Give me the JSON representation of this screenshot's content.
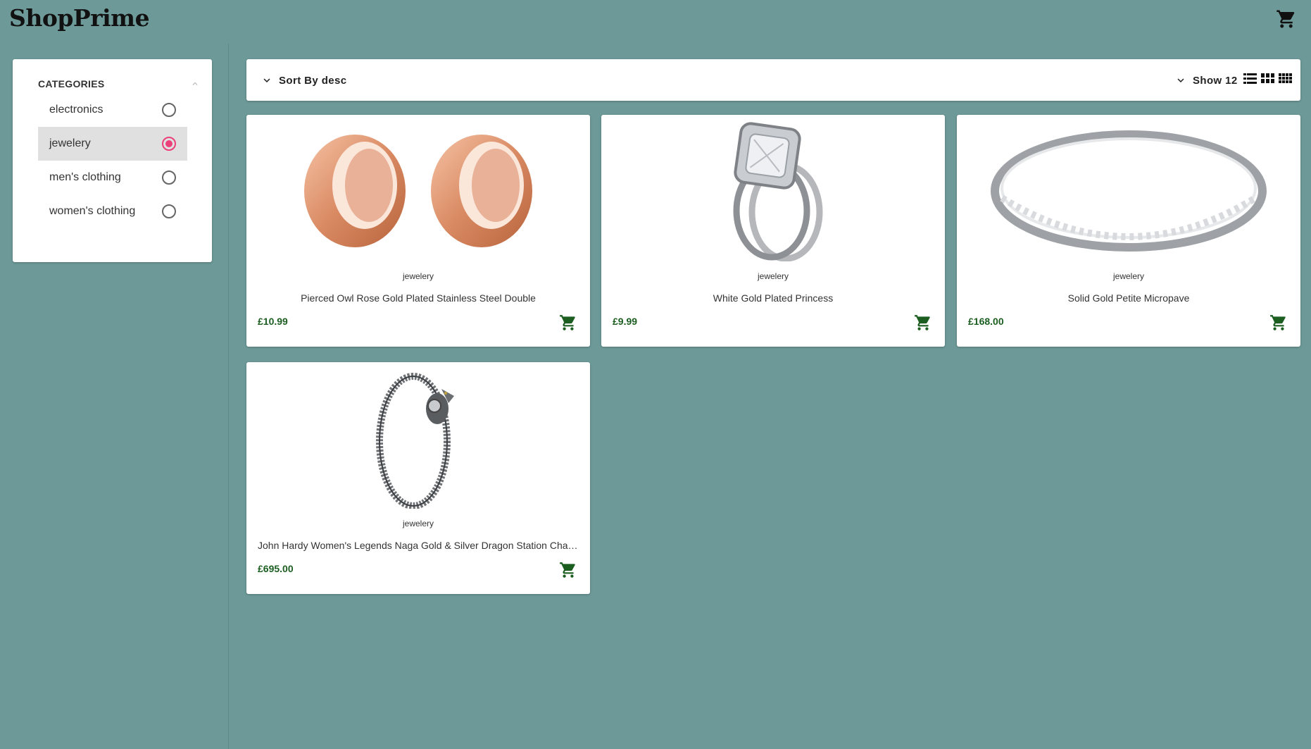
{
  "app": {
    "logo": "ShopPrime"
  },
  "sidebar": {
    "title": "CATEGORIES",
    "items": [
      {
        "label": "electronics",
        "selected": false
      },
      {
        "label": "jewelery",
        "selected": true
      },
      {
        "label": "men's clothing",
        "selected": false
      },
      {
        "label": "women's clothing",
        "selected": false
      }
    ]
  },
  "toolbar": {
    "sort_label": "Sort By desc",
    "show_label": "Show 12"
  },
  "products": [
    {
      "category": "jewelery",
      "title": "Pierced Owl Rose Gold Plated Stainless Steel Double",
      "price": "£10.99",
      "image": "rose-gold-tunnel-plugs"
    },
    {
      "category": "jewelery",
      "title": "White Gold Plated Princess",
      "price": "£9.99",
      "image": "diamond-ring-set"
    },
    {
      "category": "jewelery",
      "title": "Solid Gold Petite Micropave",
      "price": "£168.00",
      "image": "silver-band-ring"
    },
    {
      "category": "jewelery",
      "title": "John Hardy Women's Legends Naga Gold & Silver Dragon Station Chain Bracelet",
      "price": "£695.00",
      "image": "dragon-bracelet"
    }
  ],
  "colors": {
    "background": "#6d9a99",
    "accent": "#ec407a",
    "price": "#1b5e20"
  }
}
